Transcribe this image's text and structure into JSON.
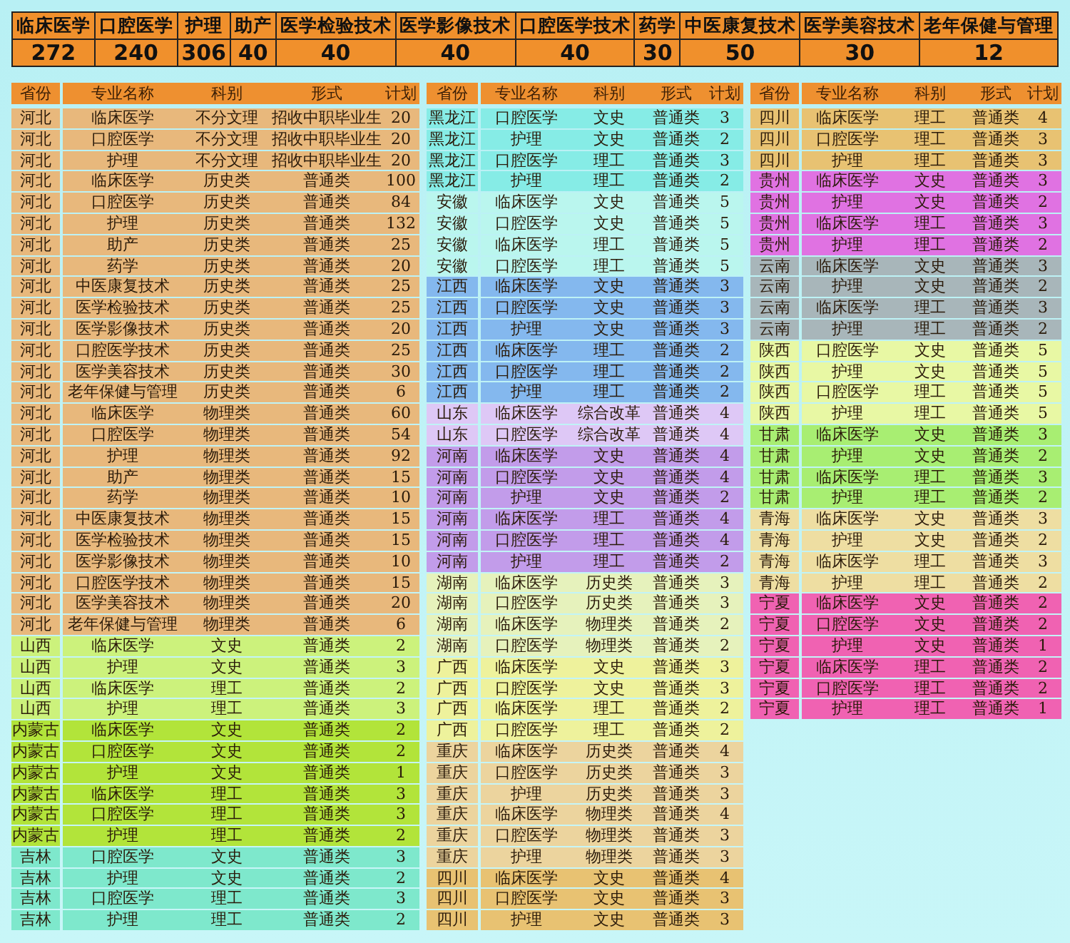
{
  "summary": [
    {
      "major": "临床医学",
      "plan": "272"
    },
    {
      "major": "口腔医学",
      "plan": "240"
    },
    {
      "major": "护理",
      "plan": "306"
    },
    {
      "major": "助产",
      "plan": "40"
    },
    {
      "major": "医学检验技术",
      "plan": "40"
    },
    {
      "major": "医学影像技术",
      "plan": "40"
    },
    {
      "major": "口腔医学技术",
      "plan": "40"
    },
    {
      "major": "药学",
      "plan": "30"
    },
    {
      "major": "中医康复技术",
      "plan": "50"
    },
    {
      "major": "医学美容技术",
      "plan": "30"
    },
    {
      "major": "老年保健与管理",
      "plan": "12"
    }
  ],
  "tables": [
    {
      "columns": [
        "省份",
        "专业名称",
        "科别",
        "形式",
        "计划"
      ],
      "groups": [
        {
          "color": "#e8b87c",
          "rows": [
            [
              "河北",
              "临床医学",
              "不分文理",
              "招收中职毕业生",
              "20"
            ],
            [
              "河北",
              "口腔医学",
              "不分文理",
              "招收中职毕业生",
              "20"
            ],
            [
              "河北",
              "护理",
              "不分文理",
              "招收中职毕业生",
              "20"
            ],
            [
              "河北",
              "临床医学",
              "历史类",
              "普通类",
              "100"
            ],
            [
              "河北",
              "口腔医学",
              "历史类",
              "普通类",
              "84"
            ],
            [
              "河北",
              "护理",
              "历史类",
              "普通类",
              "132"
            ],
            [
              "河北",
              "助产",
              "历史类",
              "普通类",
              "25"
            ],
            [
              "河北",
              "药学",
              "历史类",
              "普通类",
              "20"
            ],
            [
              "河北",
              "中医康复技术",
              "历史类",
              "普通类",
              "25"
            ],
            [
              "河北",
              "医学检验技术",
              "历史类",
              "普通类",
              "25"
            ],
            [
              "河北",
              "医学影像技术",
              "历史类",
              "普通类",
              "20"
            ],
            [
              "河北",
              "口腔医学技术",
              "历史类",
              "普通类",
              "25"
            ],
            [
              "河北",
              "医学美容技术",
              "历史类",
              "普通类",
              "30"
            ],
            [
              "河北",
              "老年保健与管理",
              "历史类",
              "普通类",
              "6"
            ],
            [
              "河北",
              "临床医学",
              "物理类",
              "普通类",
              "60"
            ],
            [
              "河北",
              "口腔医学",
              "物理类",
              "普通类",
              "54"
            ],
            [
              "河北",
              "护理",
              "物理类",
              "普通类",
              "92"
            ],
            [
              "河北",
              "助产",
              "物理类",
              "普通类",
              "15"
            ],
            [
              "河北",
              "药学",
              "物理类",
              "普通类",
              "10"
            ],
            [
              "河北",
              "中医康复技术",
              "物理类",
              "普通类",
              "15"
            ],
            [
              "河北",
              "医学检验技术",
              "物理类",
              "普通类",
              "15"
            ],
            [
              "河北",
              "医学影像技术",
              "物理类",
              "普通类",
              "10"
            ],
            [
              "河北",
              "口腔医学技术",
              "物理类",
              "普通类",
              "15"
            ],
            [
              "河北",
              "医学美容技术",
              "物理类",
              "普通类",
              "20"
            ],
            [
              "河北",
              "老年保健与管理",
              "物理类",
              "普通类",
              "6"
            ]
          ]
        },
        {
          "color": "#ccf27c",
          "rows": [
            [
              "山西",
              "临床医学",
              "文史",
              "普通类",
              "2"
            ],
            [
              "山西",
              "护理",
              "文史",
              "普通类",
              "3"
            ],
            [
              "山西",
              "临床医学",
              "理工",
              "普通类",
              "2"
            ],
            [
              "山西",
              "护理",
              "理工",
              "普通类",
              "3"
            ]
          ]
        },
        {
          "color": "#b2e43a",
          "rows": [
            [
              "内蒙古",
              "临床医学",
              "文史",
              "普通类",
              "2"
            ],
            [
              "内蒙古",
              "口腔医学",
              "文史",
              "普通类",
              "2"
            ],
            [
              "内蒙古",
              "护理",
              "文史",
              "普通类",
              "1"
            ],
            [
              "内蒙古",
              "临床医学",
              "理工",
              "普通类",
              "3"
            ],
            [
              "内蒙古",
              "口腔医学",
              "理工",
              "普通类",
              "3"
            ],
            [
              "内蒙古",
              "护理",
              "理工",
              "普通类",
              "2"
            ]
          ]
        },
        {
          "color": "#7ee8cc",
          "rows": [
            [
              "吉林",
              "口腔医学",
              "文史",
              "普通类",
              "3"
            ],
            [
              "吉林",
              "护理",
              "文史",
              "普通类",
              "2"
            ],
            [
              "吉林",
              "口腔医学",
              "理工",
              "普通类",
              "3"
            ],
            [
              "吉林",
              "护理",
              "理工",
              "普通类",
              "2"
            ]
          ]
        }
      ]
    },
    {
      "columns": [
        "省份",
        "专业名称",
        "科别",
        "形式",
        "计划"
      ],
      "groups": [
        {
          "color": "#86ece6",
          "rows": [
            [
              "黑龙江",
              "口腔医学",
              "文史",
              "普通类",
              "3"
            ],
            [
              "黑龙江",
              "护理",
              "文史",
              "普通类",
              "2"
            ],
            [
              "黑龙江",
              "口腔医学",
              "理工",
              "普通类",
              "3"
            ],
            [
              "黑龙江",
              "护理",
              "理工",
              "普通类",
              "2"
            ]
          ]
        },
        {
          "color": "#baf6ee",
          "rows": [
            [
              "安徽",
              "临床医学",
              "文史",
              "普通类",
              "5"
            ],
            [
              "安徽",
              "口腔医学",
              "文史",
              "普通类",
              "5"
            ],
            [
              "安徽",
              "临床医学",
              "理工",
              "普通类",
              "5"
            ],
            [
              "安徽",
              "口腔医学",
              "理工",
              "普通类",
              "5"
            ]
          ]
        },
        {
          "color": "#84b8ee",
          "rows": [
            [
              "江西",
              "临床医学",
              "文史",
              "普通类",
              "3"
            ],
            [
              "江西",
              "口腔医学",
              "文史",
              "普通类",
              "3"
            ],
            [
              "江西",
              "护理",
              "文史",
              "普通类",
              "3"
            ],
            [
              "江西",
              "临床医学",
              "理工",
              "普通类",
              "2"
            ],
            [
              "江西",
              "口腔医学",
              "理工",
              "普通类",
              "2"
            ],
            [
              "江西",
              "护理",
              "理工",
              "普通类",
              "2"
            ]
          ]
        },
        {
          "color": "#dec8f6",
          "rows": [
            [
              "山东",
              "临床医学",
              "综合改革",
              "普通类",
              "4"
            ],
            [
              "山东",
              "口腔医学",
              "综合改革",
              "普通类",
              "4"
            ]
          ]
        },
        {
          "color": "#c29cea",
          "rows": [
            [
              "河南",
              "临床医学",
              "文史",
              "普通类",
              "4"
            ],
            [
              "河南",
              "口腔医学",
              "文史",
              "普通类",
              "4"
            ],
            [
              "河南",
              "护理",
              "文史",
              "普通类",
              "2"
            ],
            [
              "河南",
              "临床医学",
              "理工",
              "普通类",
              "4"
            ],
            [
              "河南",
              "口腔医学",
              "理工",
              "普通类",
              "4"
            ],
            [
              "河南",
              "护理",
              "理工",
              "普通类",
              "2"
            ]
          ]
        },
        {
          "color": "#e6f2bc",
          "rows": [
            [
              "湖南",
              "临床医学",
              "历史类",
              "普通类",
              "3"
            ],
            [
              "湖南",
              "口腔医学",
              "历史类",
              "普通类",
              "3"
            ],
            [
              "湖南",
              "临床医学",
              "物理类",
              "普通类",
              "2"
            ],
            [
              "湖南",
              "口腔医学",
              "物理类",
              "普通类",
              "2"
            ]
          ]
        },
        {
          "color": "#eef29c",
          "rows": [
            [
              "广西",
              "临床医学",
              "文史",
              "普通类",
              "3"
            ],
            [
              "广西",
              "口腔医学",
              "文史",
              "普通类",
              "3"
            ],
            [
              "广西",
              "临床医学",
              "理工",
              "普通类",
              "2"
            ],
            [
              "广西",
              "口腔医学",
              "理工",
              "普通类",
              "2"
            ]
          ]
        },
        {
          "color": "#ecd49e",
          "rows": [
            [
              "重庆",
              "临床医学",
              "历史类",
              "普通类",
              "4"
            ],
            [
              "重庆",
              "口腔医学",
              "历史类",
              "普通类",
              "3"
            ],
            [
              "重庆",
              "护理",
              "历史类",
              "普通类",
              "3"
            ],
            [
              "重庆",
              "临床医学",
              "物理类",
              "普通类",
              "4"
            ],
            [
              "重庆",
              "口腔医学",
              "物理类",
              "普通类",
              "3"
            ],
            [
              "重庆",
              "护理",
              "物理类",
              "普通类",
              "3"
            ]
          ]
        },
        {
          "color": "#e8c272",
          "rows": [
            [
              "四川",
              "临床医学",
              "文史",
              "普通类",
              "4"
            ],
            [
              "四川",
              "口腔医学",
              "文史",
              "普通类",
              "3"
            ],
            [
              "四川",
              "护理",
              "文史",
              "普通类",
              "3"
            ]
          ]
        }
      ]
    },
    {
      "columns": [
        "省份",
        "专业名称",
        "科别",
        "形式",
        "计划"
      ],
      "groups": [
        {
          "color": "#e8c272",
          "rows": [
            [
              "四川",
              "临床医学",
              "理工",
              "普通类",
              "4"
            ],
            [
              "四川",
              "口腔医学",
              "理工",
              "普通类",
              "3"
            ],
            [
              "四川",
              "护理",
              "理工",
              "普通类",
              "3"
            ]
          ]
        },
        {
          "color": "#e072e2",
          "rows": [
            [
              "贵州",
              "临床医学",
              "文史",
              "普通类",
              "3"
            ],
            [
              "贵州",
              "护理",
              "文史",
              "普通类",
              "2"
            ],
            [
              "贵州",
              "临床医学",
              "理工",
              "普通类",
              "3"
            ],
            [
              "贵州",
              "护理",
              "理工",
              "普通类",
              "2"
            ]
          ]
        },
        {
          "color": "#a8b6ba",
          "rows": [
            [
              "云南",
              "临床医学",
              "文史",
              "普通类",
              "3"
            ],
            [
              "云南",
              "护理",
              "文史",
              "普通类",
              "2"
            ],
            [
              "云南",
              "临床医学",
              "理工",
              "普通类",
              "3"
            ],
            [
              "云南",
              "护理",
              "理工",
              "普通类",
              "2"
            ]
          ]
        },
        {
          "color": "#e8f8a4",
          "rows": [
            [
              "陕西",
              "口腔医学",
              "文史",
              "普通类",
              "5"
            ],
            [
              "陕西",
              "护理",
              "文史",
              "普通类",
              "5"
            ],
            [
              "陕西",
              "口腔医学",
              "理工",
              "普通类",
              "5"
            ],
            [
              "陕西",
              "护理",
              "理工",
              "普通类",
              "5"
            ]
          ]
        },
        {
          "color": "#a8ee72",
          "rows": [
            [
              "甘肃",
              "临床医学",
              "文史",
              "普通类",
              "3"
            ],
            [
              "甘肃",
              "护理",
              "文史",
              "普通类",
              "2"
            ],
            [
              "甘肃",
              "临床医学",
              "理工",
              "普通类",
              "3"
            ],
            [
              "甘肃",
              "护理",
              "理工",
              "普通类",
              "2"
            ]
          ]
        },
        {
          "color": "#eedea2",
          "rows": [
            [
              "青海",
              "临床医学",
              "文史",
              "普通类",
              "3"
            ],
            [
              "青海",
              "护理",
              "文史",
              "普通类",
              "2"
            ],
            [
              "青海",
              "临床医学",
              "理工",
              "普通类",
              "3"
            ],
            [
              "青海",
              "护理",
              "理工",
              "普通类",
              "2"
            ]
          ]
        },
        {
          "color": "#f062b2",
          "rows": [
            [
              "宁夏",
              "临床医学",
              "文史",
              "普通类",
              "2"
            ],
            [
              "宁夏",
              "口腔医学",
              "文史",
              "普通类",
              "2"
            ],
            [
              "宁夏",
              "护理",
              "文史",
              "普通类",
              "1"
            ],
            [
              "宁夏",
              "临床医学",
              "理工",
              "普通类",
              "2"
            ],
            [
              "宁夏",
              "口腔医学",
              "理工",
              "普通类",
              "2"
            ],
            [
              "宁夏",
              "护理",
              "理工",
              "普通类",
              "1"
            ]
          ]
        }
      ]
    }
  ]
}
